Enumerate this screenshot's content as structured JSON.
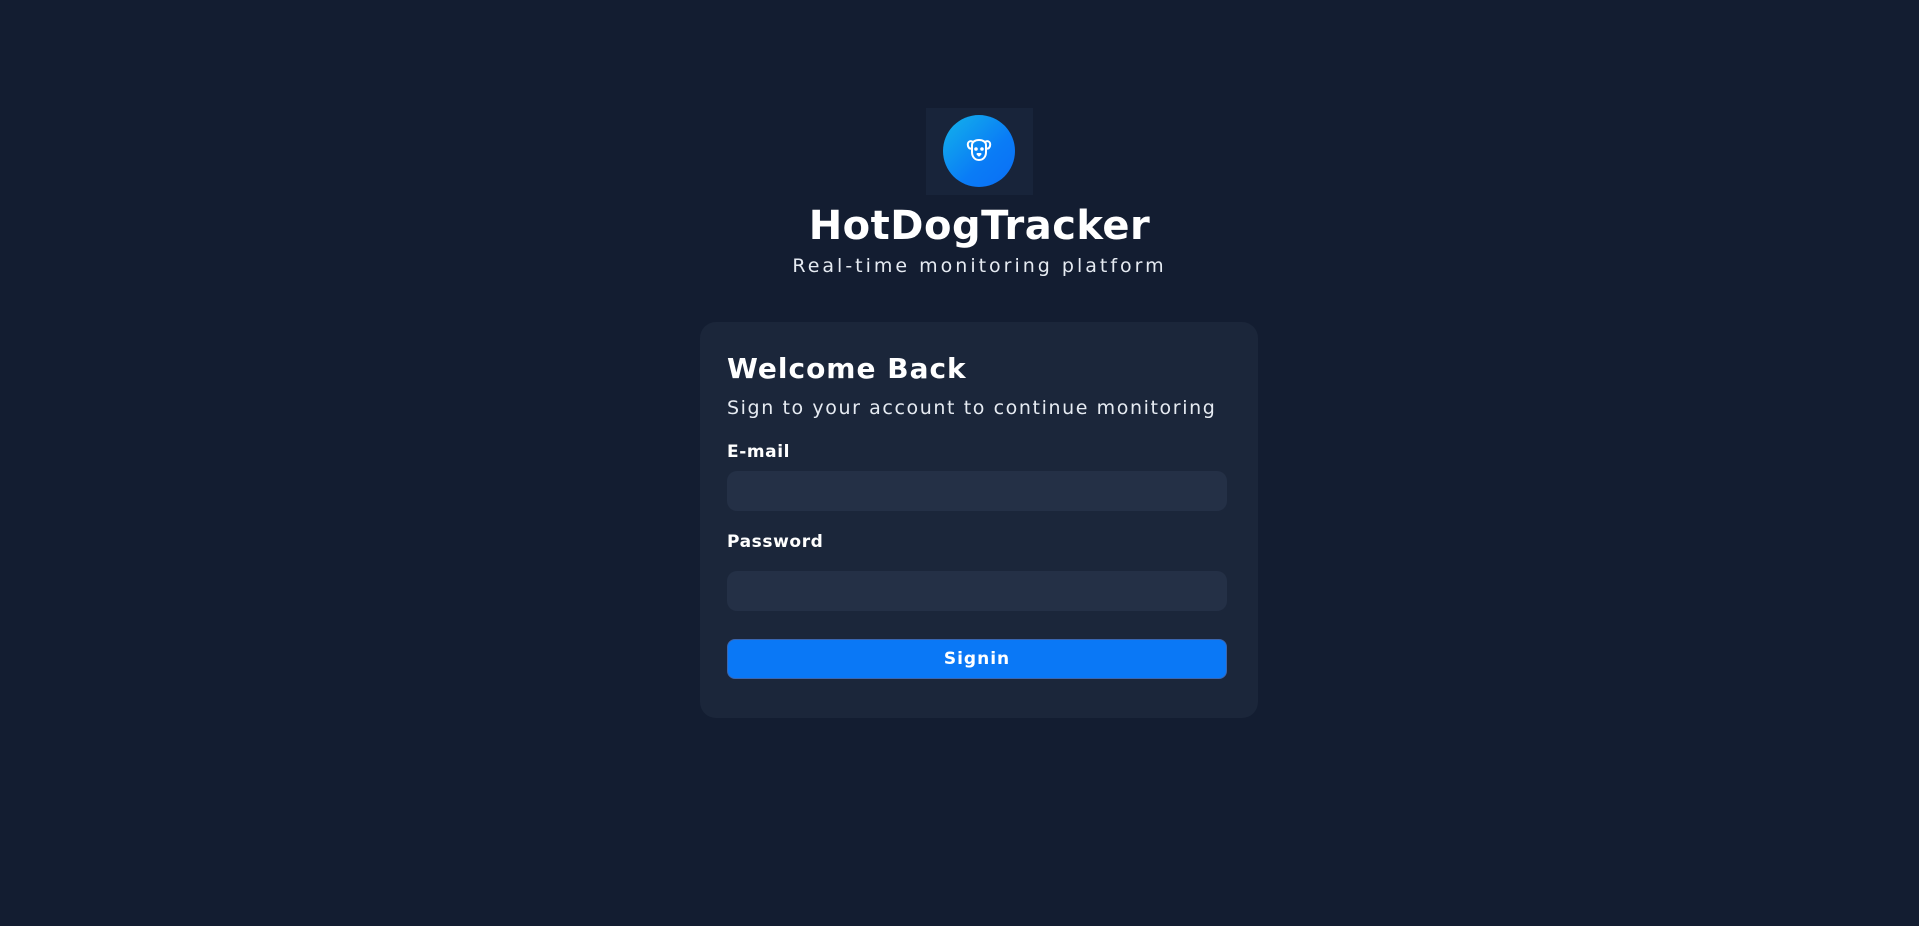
{
  "brand": {
    "title": "HotDogTracker",
    "subtitle": "Real-time monitoring platform",
    "logo_icon": "dog-face-icon",
    "accent_gradient": [
      "#13b4ea",
      "#0a6ef5"
    ]
  },
  "login_card": {
    "title": "Welcome Back",
    "subtitle": "Sign to your account to continue monitoring",
    "email": {
      "label": "E-mail",
      "value": "",
      "placeholder": ""
    },
    "password": {
      "label": "Password",
      "value": "",
      "placeholder": ""
    },
    "submit_label": "Signin"
  },
  "colors": {
    "background": "#131d31",
    "card": "#1b263a",
    "input": "#243046",
    "button": "#0a78f6"
  }
}
